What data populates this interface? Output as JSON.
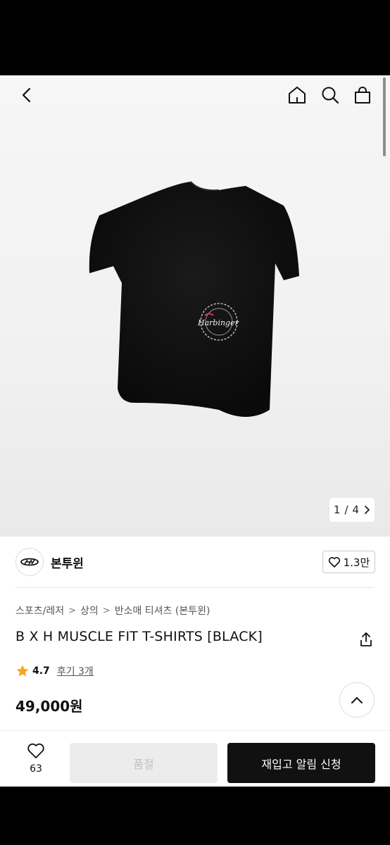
{
  "hero": {
    "counter_current": "1",
    "counter_separator": "/",
    "counter_total": "4",
    "print_text": "Harbinger"
  },
  "brand": {
    "name": "본투윈",
    "likes": "1.3만"
  },
  "breadcrumb": [
    "스포츠/레저",
    "상의",
    "반소매 티셔츠 (본투윈)"
  ],
  "product": {
    "title": "B X H MUSCLE FIT T-SHIRTS [BLACK]",
    "rating": "4.7",
    "reviews": "후기 3개",
    "price": "49,000원"
  },
  "actions": {
    "wish_count": "63",
    "soldout_label": "품절",
    "restock_label": "재입고 알림 신청"
  },
  "colors": {
    "accent_star": "#f5a623",
    "primary_button": "#111111",
    "disabled_button": "#ececec"
  }
}
